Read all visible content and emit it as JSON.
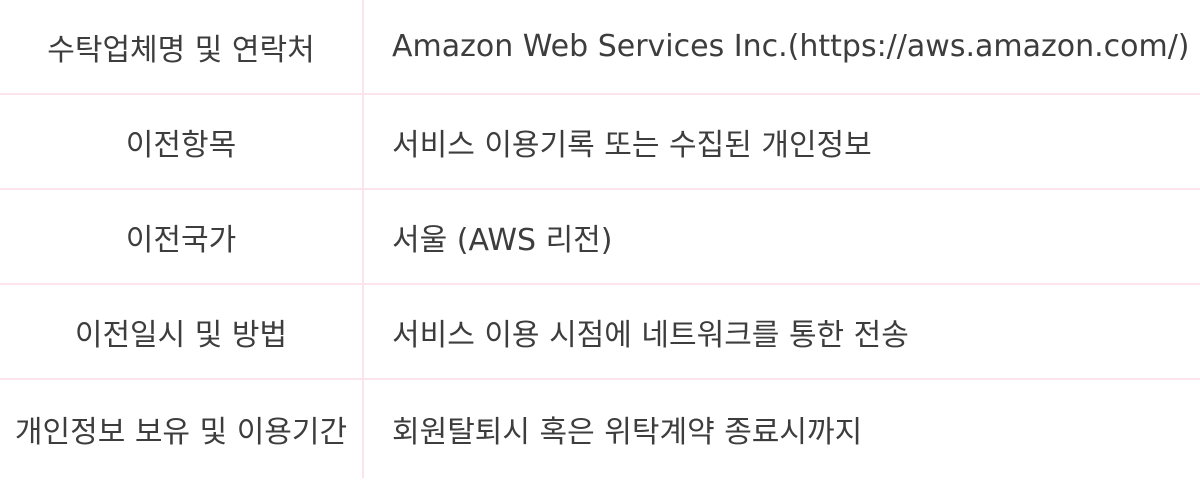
{
  "rows": [
    {
      "label": "수탁업체명 및 연락처",
      "value": "Amazon Web Services Inc.(https://aws.amazon.com/)"
    },
    {
      "label": "이전항목",
      "value": "서비스 이용기록 또는 수집된 개인정보"
    },
    {
      "label": "이전국가",
      "value": "서울 (AWS 리전)"
    },
    {
      "label": "이전일시 및 방법",
      "value": "서비스 이용 시점에 네트워크를 통한 전송"
    },
    {
      "label": "개인정보 보유 및 이용기간",
      "value": "회원탈퇴시 혹은 위탁계약 종료시까지"
    }
  ],
  "colors": {
    "border": "#fbe4ec",
    "text": "#3d3d3d"
  }
}
